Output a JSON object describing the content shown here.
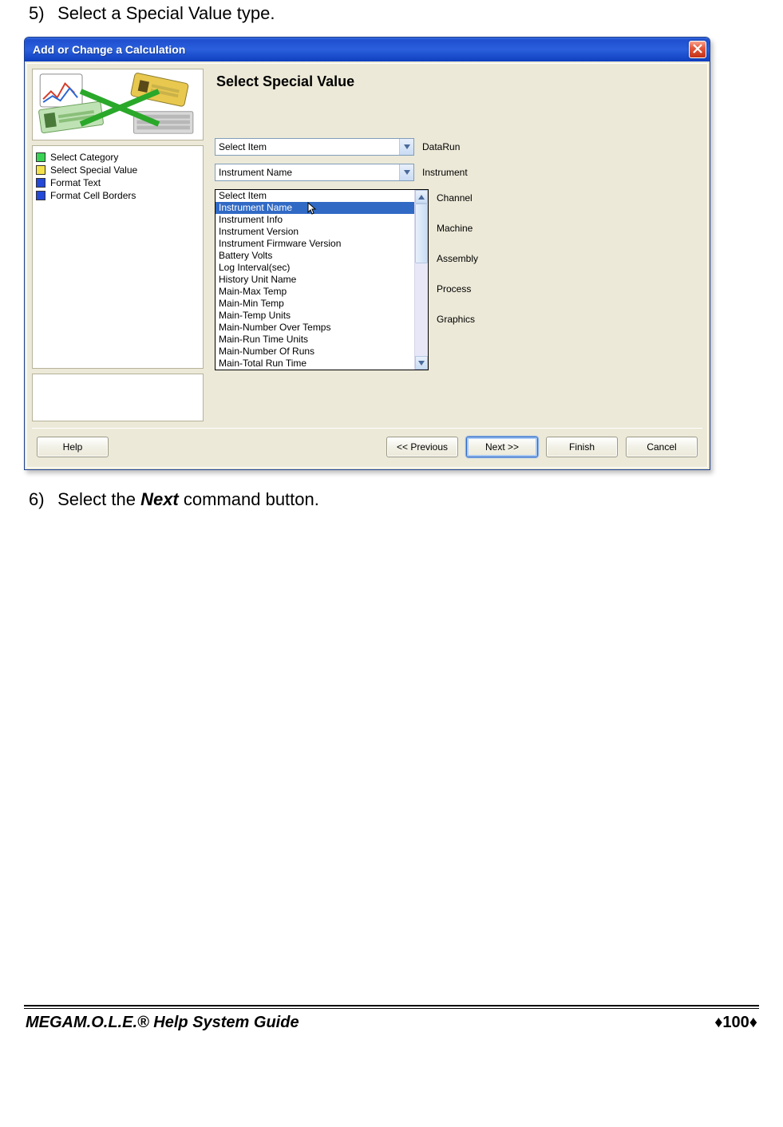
{
  "step5": {
    "num": "5)",
    "text": "Select a Special Value type."
  },
  "step6": {
    "num": "6)",
    "pre": "Select the ",
    "bold": "Next",
    "post": " command button."
  },
  "dialog": {
    "title": "Add or Change a Calculation",
    "section_title": "Select Special Value",
    "wizard_steps": [
      {
        "color": "#39d353",
        "label": "Select Category"
      },
      {
        "color": "#f4e24c",
        "label": "Select Special Value"
      },
      {
        "color": "#2448d8",
        "label": "Format Text"
      },
      {
        "color": "#2448d8",
        "label": "Format Cell Borders"
      }
    ],
    "combo1": {
      "value": "Select Item",
      "label": "DataRun"
    },
    "combo2": {
      "value": "Instrument Name",
      "label": "Instrument"
    },
    "side_labels": [
      "Channel",
      "Machine",
      "Assembly",
      "Process",
      "Graphics"
    ],
    "list_items": [
      "Select Item",
      "Instrument Name",
      "Instrument Info",
      "Instrument Version",
      "Instrument Firmware Version",
      "Battery Volts",
      "Log Interval(sec)",
      "History Unit Name",
      "Main-Max Temp",
      "Main-Min Temp",
      "Main-Temp Units",
      "Main-Number Over Temps",
      "Main-Run Time Units",
      "Main-Number Of Runs",
      "Main-Total Run Time"
    ],
    "selected_index": 1,
    "buttons": {
      "help": "Help",
      "prev": "<< Previous",
      "next": "Next >>",
      "finish": "Finish",
      "cancel": "Cancel"
    }
  },
  "footer": {
    "left_italic": "MEGA",
    "left_rest": "M.O.L.E.® Help System Guide",
    "page": "100"
  }
}
